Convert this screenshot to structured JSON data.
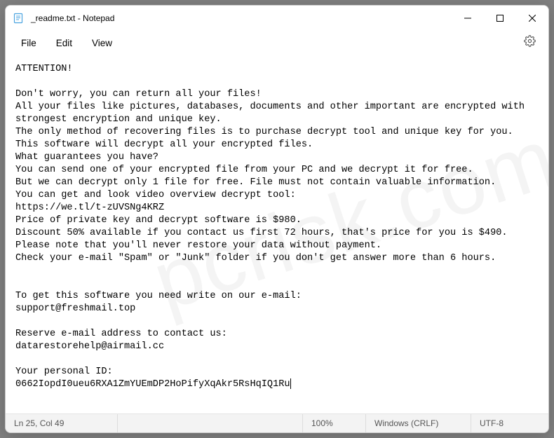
{
  "titlebar": {
    "title": "_readme.txt - Notepad"
  },
  "menu": {
    "file": "File",
    "edit": "Edit",
    "view": "View"
  },
  "content": {
    "lines": [
      "ATTENTION!",
      "",
      "Don't worry, you can return all your files!",
      "All your files like pictures, databases, documents and other important are encrypted with strongest encryption and unique key.",
      "The only method of recovering files is to purchase decrypt tool and unique key for you.",
      "This software will decrypt all your encrypted files.",
      "What guarantees you have?",
      "You can send one of your encrypted file from your PC and we decrypt it for free.",
      "But we can decrypt only 1 file for free. File must not contain valuable information.",
      "You can get and look video overview decrypt tool:",
      "https://we.tl/t-zUVSNg4KRZ",
      "Price of private key and decrypt software is $980.",
      "Discount 50% available if you contact us first 72 hours, that's price for you is $490.",
      "Please note that you'll never restore your data without payment.",
      "Check your e-mail \"Spam\" or \"Junk\" folder if you don't get answer more than 6 hours.",
      "",
      "",
      "To get this software you need write on our e-mail:",
      "support@freshmail.top",
      "",
      "Reserve e-mail address to contact us:",
      "datarestorehelp@airmail.cc",
      "",
      "Your personal ID:",
      "0662IopdI0ueu6RXA1ZmYUEmDP2HoPifyXqAkr5RsHqIQ1Ru"
    ]
  },
  "status": {
    "position": "Ln 25, Col 49",
    "zoom": "100%",
    "line_ending": "Windows (CRLF)",
    "encoding": "UTF-8"
  },
  "watermark": "pcrisk.com"
}
